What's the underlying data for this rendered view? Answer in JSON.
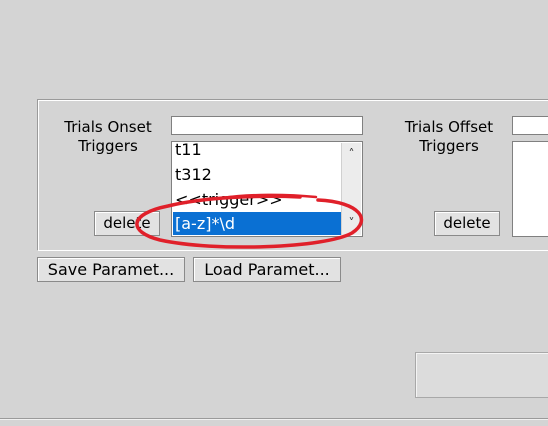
{
  "onset": {
    "label": "Trials Onset\nTriggers",
    "input_value": "",
    "items": [
      "t11",
      "t312",
      "<<trigger>>",
      "[a-z]*\\d"
    ],
    "selected_index": 3,
    "delete_label": "delete"
  },
  "offset": {
    "label": "Trials Offset\nTriggers",
    "input_value": "",
    "delete_label": "delete"
  },
  "buttons": {
    "save_label": "Save Paramet...",
    "load_label": "Load Paramet..."
  },
  "icons": {
    "scroll_up": "chevron-up-icon",
    "scroll_down": "chevron-down-icon"
  },
  "colors": {
    "selection": "#0a70d3",
    "annotation": "#e0202a"
  }
}
